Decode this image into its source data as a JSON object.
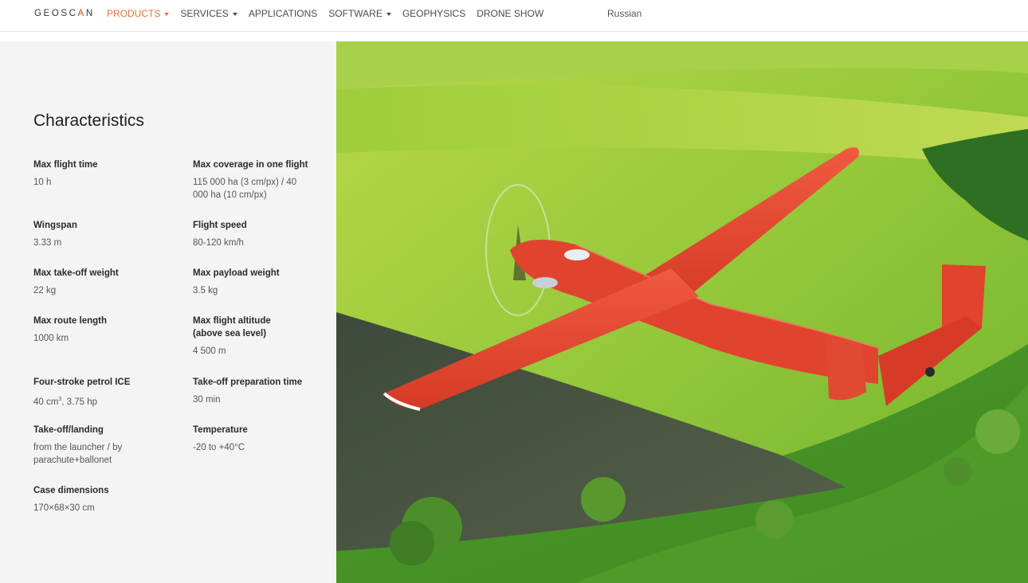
{
  "header": {
    "logo_pre": "GEOSC",
    "logo_accent": "A",
    "logo_post": "N",
    "nav": [
      {
        "label": "PRODUCTS",
        "dropdown": true,
        "active": true
      },
      {
        "label": "SERVICES",
        "dropdown": true,
        "active": false
      },
      {
        "label": "APPLICATIONS",
        "dropdown": false,
        "active": false
      },
      {
        "label": "SOFTWARE",
        "dropdown": true,
        "active": false
      },
      {
        "label": "GEOPHYSICS",
        "dropdown": false,
        "active": false
      },
      {
        "label": "DRONE SHOW",
        "dropdown": false,
        "active": false
      }
    ],
    "language": "Russian"
  },
  "colors": {
    "accent": "#e0733a",
    "panel_bg": "#f4f4f4",
    "drone_red": "#e8432e"
  },
  "characteristics": {
    "title": "Characteristics",
    "specs": [
      {
        "label": "Max flight time",
        "value": "10 h"
      },
      {
        "label": "Max coverage in one flight",
        "value": "115 000 ha (3 cm/px) / 40 000 ha (10 cm/px)"
      },
      {
        "label": "Wingspan",
        "value": "3.33 m"
      },
      {
        "label": "Flight speed",
        "value": "80-120 km/h"
      },
      {
        "label": "Max take-off weight",
        "value": "22 kg"
      },
      {
        "label": "Max payload weight",
        "value": "3.5 kg"
      },
      {
        "label": "Max route length",
        "value": "1000 km"
      },
      {
        "label": "Max flight altitude (above sea level)",
        "value": "4 500 m"
      },
      {
        "label": "Four-stroke petrol ICE",
        "value_pre": "40 cm",
        "value_sup": "3",
        "value_post": ", 3.75 hp"
      },
      {
        "label": "Take-off preparation time",
        "value": "30 min"
      },
      {
        "label": "Take-off/landing",
        "value": "from the launcher / by parachute+ballonet"
      },
      {
        "label": "Temperature",
        "value": "-20 to +40°C"
      },
      {
        "label": "Case dimensions",
        "value": "170×68×30 cm"
      }
    ]
  },
  "photo": {
    "subject": "red fixed-wing drone over green fields"
  }
}
